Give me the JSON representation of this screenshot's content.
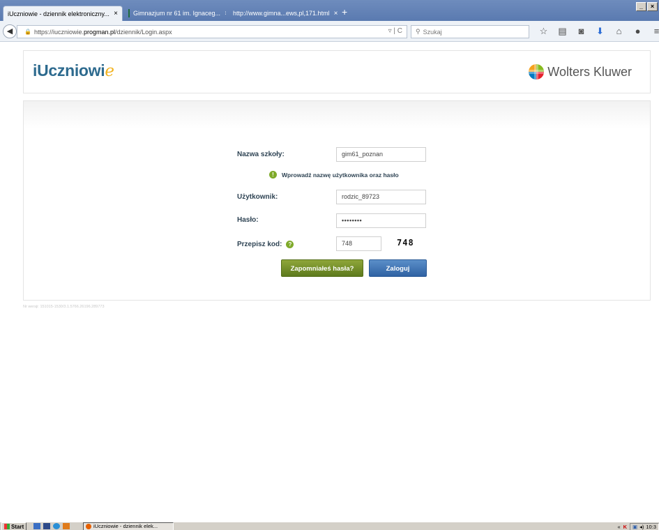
{
  "browser": {
    "tabs": [
      {
        "label": "iUczniowie - dziennik elektroniczny...",
        "active": true
      },
      {
        "label": "Gimnazjum nr 61 im. Ignaceg...",
        "active": false
      },
      {
        "label": "http://www.gimna...ews,pl,171.html",
        "active": false
      }
    ],
    "url_prefix": "https://iuczniowie.",
    "url_host": "progman.pl",
    "url_suffix": "/dziennik/Login.aspx",
    "search_placeholder": "Szukaj",
    "window_buttons": [
      "_",
      "×"
    ]
  },
  "header": {
    "logo_main": "iUczniowi",
    "logo_e": "e",
    "brand": "Wolters Kluwer"
  },
  "form": {
    "school_label": "Nazwa szkoły:",
    "school_value": "gim61_poznan",
    "info_text": "Wprowadź nazwę użytkownika oraz hasło",
    "user_label": "Użytkownik:",
    "user_value": "rodzic_89723",
    "password_label": "Hasło:",
    "password_value": "••••••••",
    "code_label": "Przepisz kod:",
    "code_value": "748",
    "captcha_text": "748",
    "forgot_button": "Zapomniałeś hasła?",
    "login_button": "Zaloguj"
  },
  "footer": {
    "version": "Nr wersji: 151015-1530/3.1.5766.26196.289773"
  },
  "taskbar": {
    "start": "Start",
    "task_item": "iUczniowie - dziennik elek...",
    "clock": "10:3"
  }
}
